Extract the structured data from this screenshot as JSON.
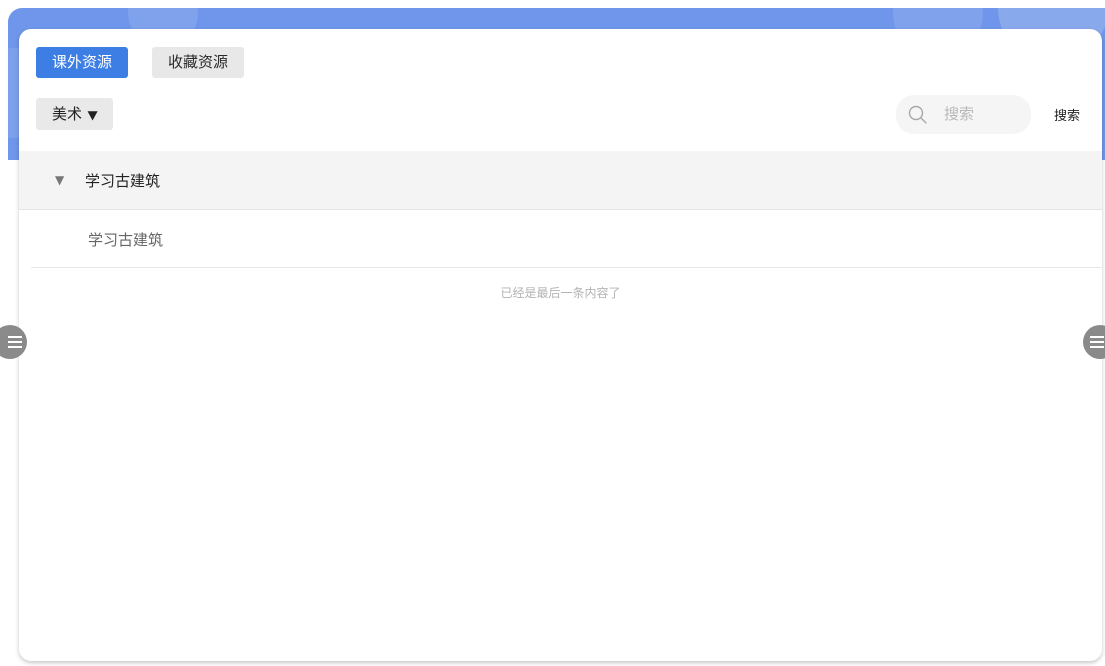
{
  "tabs": [
    {
      "label": "课外资源",
      "active": true
    },
    {
      "label": "收藏资源",
      "active": false
    }
  ],
  "filter": {
    "subject_label": "美术",
    "caret_icon": "caret-down-icon"
  },
  "search": {
    "placeholder": "搜索",
    "value": "",
    "button_label": "搜索",
    "icon": "search-icon"
  },
  "category": {
    "label": "学习古建筑",
    "expanded": true,
    "items": [
      {
        "label": "学习古建筑"
      }
    ]
  },
  "list_end_text": "已经是最后一条内容了",
  "side_handles": {
    "icon": "menu-lines-icon"
  },
  "colors": {
    "accent": "#3d7ee4",
    "header_band": "#6f96ea",
    "inactive_tab": "#e8e8e8",
    "handle": "#8a8a8a"
  }
}
